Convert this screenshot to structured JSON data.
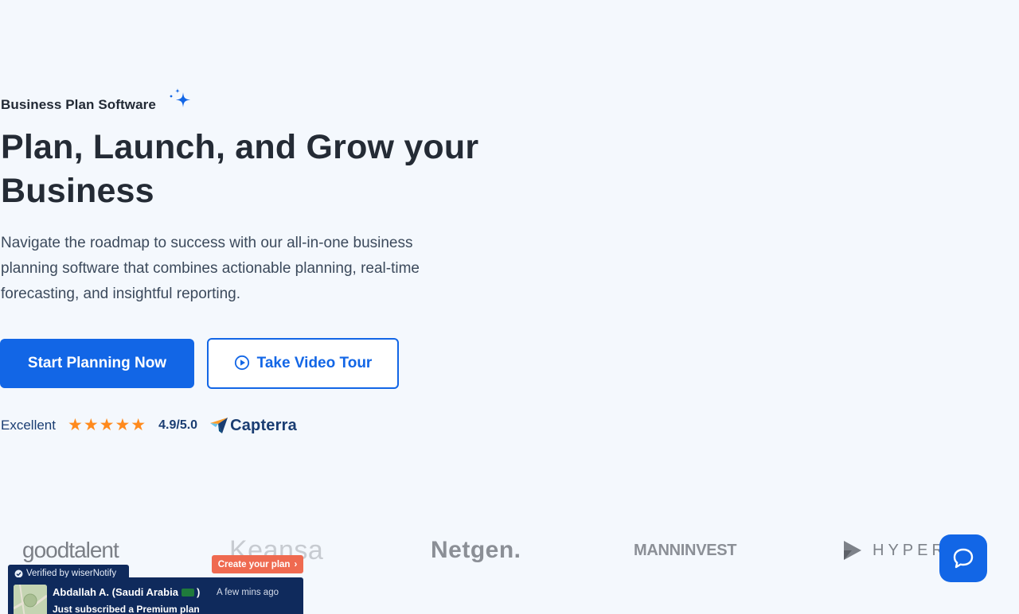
{
  "hero": {
    "eyebrow": "Business Plan Software",
    "headline": "Plan, Launch, and Grow your Business",
    "subtext": "Navigate the roadmap to success with our all-in-one business planning software that combines actionable planning, real-time forecasting, and insightful reporting.",
    "primary_button": "Start Planning Now",
    "secondary_button": "Take Video Tour"
  },
  "rating": {
    "label": "Excellent",
    "stars": 5,
    "score": "4.9/5.0",
    "source": "Capterra"
  },
  "logos": [
    "goodtalent",
    "Keansa",
    "Netgen.",
    "MANNINVEST",
    "HYPER"
  ],
  "notification": {
    "verified_label": "Verified by wiserNotify",
    "cta_label": "Create your plan",
    "name": "Abdallah A. (Saudi Arabia",
    "name_suffix": ")",
    "time": "A few mins ago",
    "message": "Just subscribed a Premium plan"
  },
  "colors": {
    "brand": "#1266e6",
    "star": "#ff8a1d",
    "notification_bg": "#0f2a5c",
    "cta_bg": "#ef6a50"
  },
  "icons": {
    "sparkle": "sparkle-icon",
    "play": "play-circle-icon",
    "capterra": "capterra-logo-icon",
    "chat": "chat-bubble-icon",
    "verified": "check-circle-icon"
  }
}
